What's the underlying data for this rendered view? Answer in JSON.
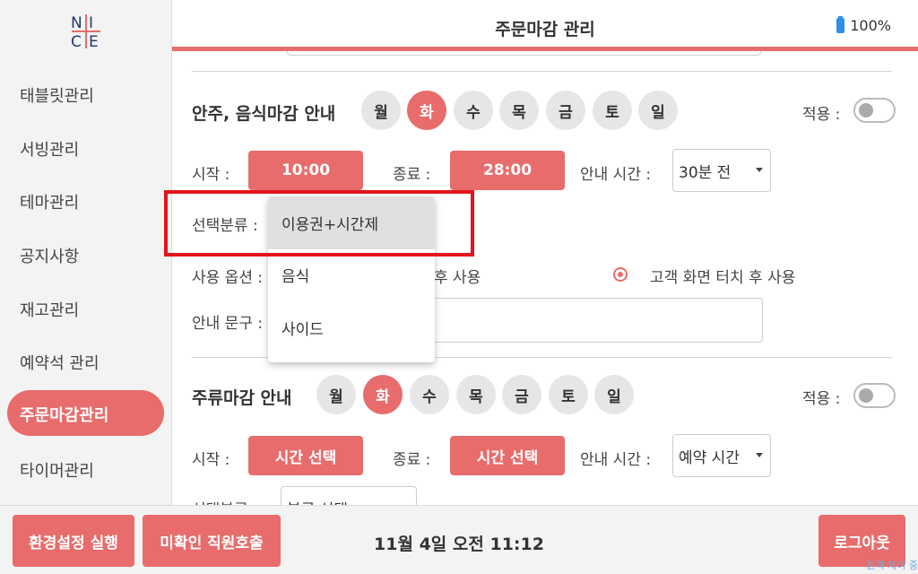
{
  "header": {
    "title": "주문마감 관리",
    "battery": "100%",
    "accent_color": "#e86c6c"
  },
  "logo": {
    "text": "NICE"
  },
  "sidebar": {
    "items": [
      {
        "label": "태블릿관리"
      },
      {
        "label": "서빙관리"
      },
      {
        "label": "테마관리"
      },
      {
        "label": "공지사항"
      },
      {
        "label": "재고관리"
      },
      {
        "label": "예약석 관리"
      },
      {
        "label": "주문마감관리",
        "active": true
      },
      {
        "label": "타이머관리"
      }
    ]
  },
  "section1": {
    "title": "안주, 음식마감 안내",
    "days": [
      "월",
      "화",
      "수",
      "목",
      "금",
      "토",
      "일"
    ],
    "active_day": "화",
    "apply_label": "적용 :",
    "start_label": "시작 :",
    "start_value": "10:00",
    "end_label": "종료 :",
    "end_value": "28:00",
    "notice_time_label": "안내 시간 :",
    "notice_time_value": "30분 전",
    "category_label": "선택분류 :",
    "usage_label": "사용 옵션 :",
    "usage_option_partial": "후 사용",
    "usage_option_selected": "고객 화면 터치 후 사용",
    "message_label": "안내 문구 :"
  },
  "dropdown": {
    "options": [
      "이용권+시간제",
      "음식",
      "사이드"
    ],
    "selected": "이용권+시간제"
  },
  "section2": {
    "title": "주류마감 안내",
    "days": [
      "월",
      "화",
      "수",
      "목",
      "금",
      "토",
      "일"
    ],
    "active_day": "화",
    "apply_label": "적용 :",
    "start_label": "시작 :",
    "start_value": "시간 선택",
    "end_label": "종료 :",
    "end_value": "시간 선택",
    "notice_time_label": "안내 시간 :",
    "notice_time_value": "예약 시간",
    "category_label": "선택분류 :",
    "category_value": "분류 선택"
  },
  "footer": {
    "settings_button": "환경설정 실행",
    "call_button": "미확인 직원호출",
    "datetime": "11월 4일 오전 11:12",
    "logout_button": "로그아웃",
    "note": "원격 제어 중"
  }
}
